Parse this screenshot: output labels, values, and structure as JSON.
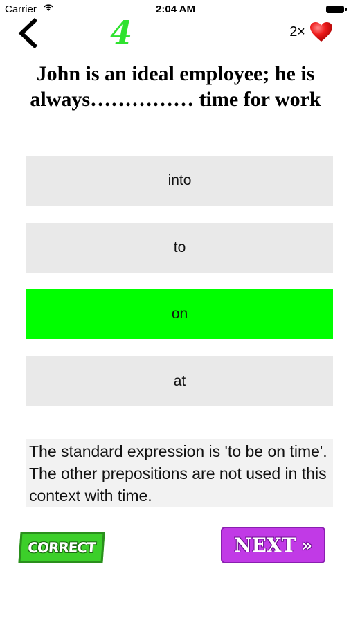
{
  "status_bar": {
    "carrier": "Carrier",
    "time": "2:04 AM",
    "wifi_icon": "wifi-icon",
    "battery_icon": "battery-icon"
  },
  "header": {
    "back_icon": "chevron-left-icon",
    "question_number": "4",
    "question_number_color": "#2fe22f",
    "lives_count": "2×",
    "lives_icon": "heart-icon"
  },
  "question": {
    "text": "John is an ideal employee; he is always…………… time for work"
  },
  "answers": [
    {
      "label": "into",
      "state": "default"
    },
    {
      "label": "to",
      "state": "default"
    },
    {
      "label": "on",
      "state": "correct"
    },
    {
      "label": "at",
      "state": "default"
    }
  ],
  "colors": {
    "answer_default": "#e9e9e9",
    "answer_correct": "#00ff00",
    "next_button": "#c13ae6",
    "correct_badge": "#3ccf2a"
  },
  "explanation": {
    "text": "The standard expression is 'to be on time'. The other prepositions are not used in this context with time."
  },
  "footer": {
    "result_badge": "CORRECT",
    "next_label": "NEXT",
    "next_icon": "double-chevron-right-icon"
  }
}
